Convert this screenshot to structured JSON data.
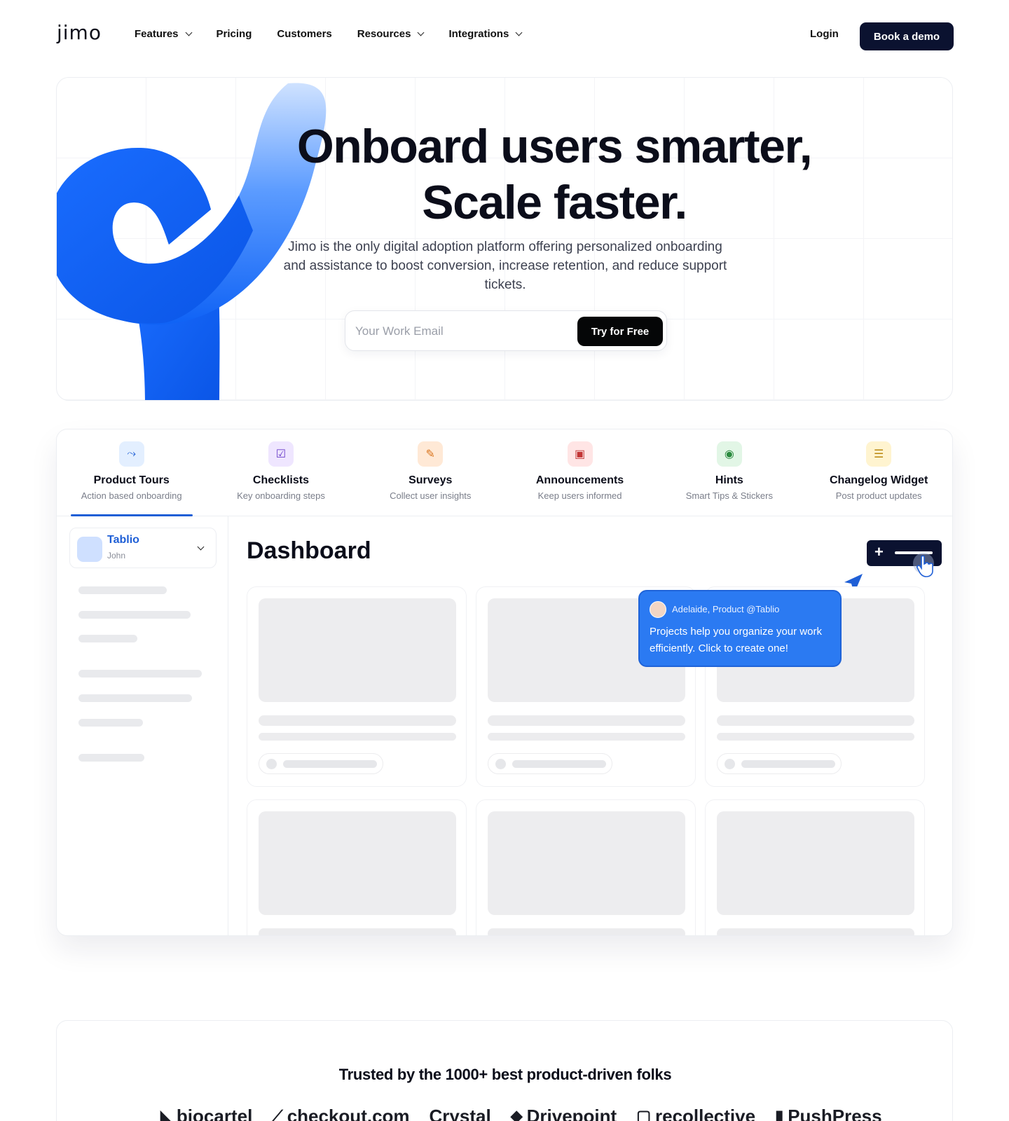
{
  "nav": {
    "logo": "jimo",
    "items": [
      {
        "label": "Features",
        "dropdown": true
      },
      {
        "label": "Pricing",
        "dropdown": false
      },
      {
        "label": "Customers",
        "dropdown": false
      },
      {
        "label": "Resources",
        "dropdown": true
      },
      {
        "label": "Integrations",
        "dropdown": true
      }
    ],
    "login": "Login",
    "demo": "Book a demo"
  },
  "hero": {
    "title_line1": "Onboard users smarter,",
    "title_line2": "Scale faster.",
    "subtitle": "Jimo is the only digital adoption platform offering personalized onboarding and assistance to boost conversion, increase retention, and reduce support tickets.",
    "email_placeholder": "Your Work Email",
    "cta": "Try for Free"
  },
  "tabs": [
    {
      "title": "Product Tours",
      "desc": "Action based onboarding",
      "icon": "route-icon",
      "glyph": "⤳",
      "bg": "#e3efff",
      "fg": "#1f5fd6",
      "active": true
    },
    {
      "title": "Checklists",
      "desc": "Key onboarding steps",
      "icon": "checklist-icon",
      "glyph": "☑",
      "bg": "#efe6ff",
      "fg": "#6b3fc9",
      "active": false
    },
    {
      "title": "Surveys",
      "desc": "Collect user insights",
      "icon": "survey-icon",
      "glyph": "✎",
      "bg": "#ffe9d6",
      "fg": "#d9731c",
      "active": false
    },
    {
      "title": "Announcements",
      "desc": "Keep users informed",
      "icon": "announcement-icon",
      "glyph": "▣",
      "bg": "#ffe5e5",
      "fg": "#c23535",
      "active": false
    },
    {
      "title": "Hints",
      "desc": "Smart Tips & Stickers",
      "icon": "hint-icon",
      "glyph": "◉",
      "bg": "#e2f6e6",
      "fg": "#2a8a3e",
      "active": false
    },
    {
      "title": "Changelog Widget",
      "desc": "Post product updates",
      "icon": "changelog-icon",
      "glyph": "☰",
      "bg": "#fff4d0",
      "fg": "#b8860b",
      "active": false
    }
  ],
  "sidebar": {
    "workspace": "Tablio",
    "user": "John"
  },
  "main": {
    "title": "Dashboard"
  },
  "tooltip": {
    "author": "Adelaide, Product @Tablio",
    "text": "Projects help you organize your work efficiently. Click to create one!"
  },
  "trusted": {
    "title": "Trusted by the 1000+ best product-driven folks",
    "logos": [
      {
        "name": "biocartel",
        "glyph": "◣"
      },
      {
        "name": "checkout.com",
        "glyph": "⟋"
      },
      {
        "name": "Crystal",
        "glyph": ""
      },
      {
        "name": "Drivepoint",
        "glyph": "◆"
      },
      {
        "name": "recollective",
        "glyph": "▢"
      },
      {
        "name": "PushPress",
        "glyph": "▮"
      }
    ]
  },
  "colors": {
    "accent": "#1f5fd6",
    "dark": "#0b1230",
    "tooltip": "#2b7af2"
  }
}
